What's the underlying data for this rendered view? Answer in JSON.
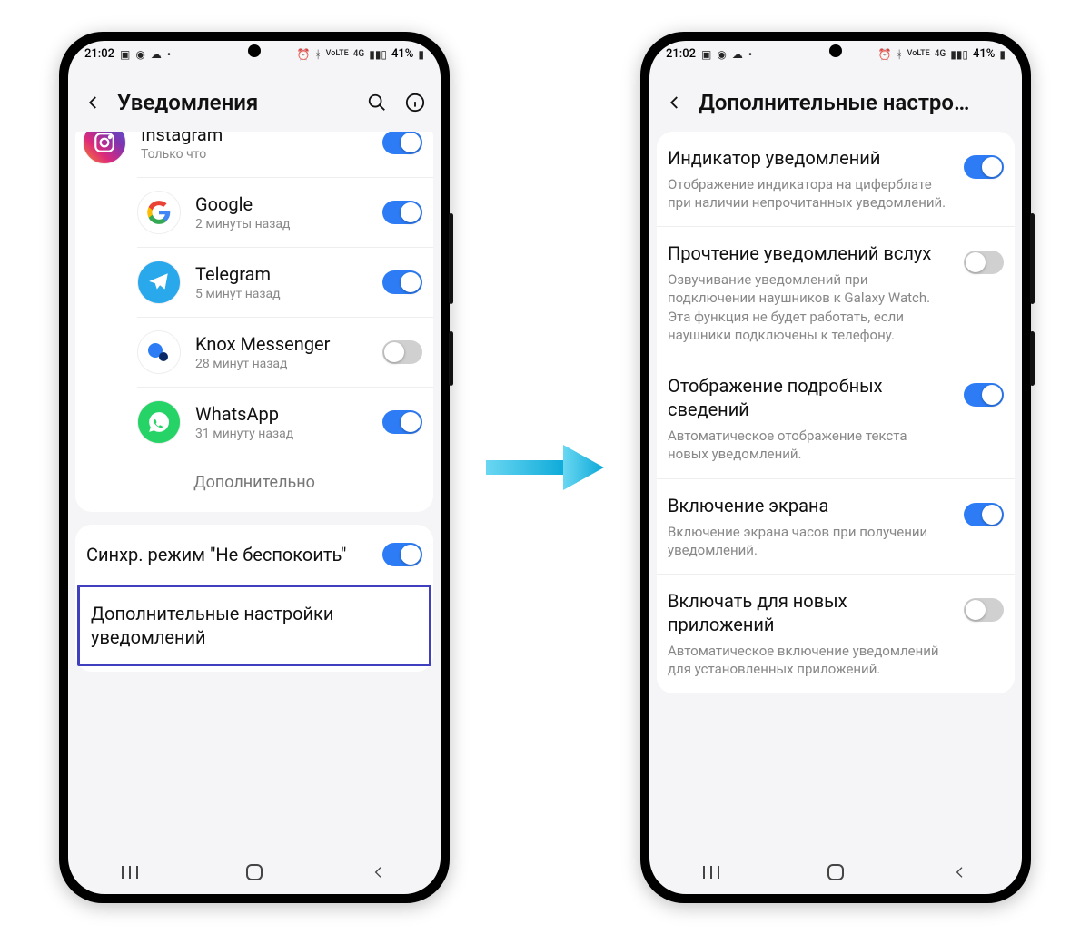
{
  "status": {
    "time": "21:02",
    "battery": "41%"
  },
  "phone1": {
    "title": "Уведомления",
    "apps": [
      {
        "name": "Instagram",
        "sub": "Только что",
        "on": true,
        "icon": "instagram"
      },
      {
        "name": "Google",
        "sub": "2 минуты назад",
        "on": true,
        "icon": "google"
      },
      {
        "name": "Telegram",
        "sub": "5 минут назад",
        "on": true,
        "icon": "telegram"
      },
      {
        "name": "Knox Messenger",
        "sub": "28 минут назад",
        "on": false,
        "icon": "knox"
      },
      {
        "name": "WhatsApp",
        "sub": "31 минуту назад",
        "on": true,
        "icon": "whatsapp"
      }
    ],
    "more": "Дополнительно",
    "sync_dnd": "Синхр. режим \"Не беспокоить\"",
    "sync_dnd_on": true,
    "extra_settings": "Дополнительные настройки уведомлений"
  },
  "phone2": {
    "title": "Дополнительные настро…",
    "settings": [
      {
        "title": "Индикатор уведомлений",
        "desc": "Отображение индикатора на циферблате при наличии непрочитанных уведомлений.",
        "on": true
      },
      {
        "title": "Прочтение уведомлений вслух",
        "desc": "Озвучивание уведомлений при подключении наушников к Galaxy Watch. Эта функция не будет работать, если наушники подключены к телефону.",
        "on": false
      },
      {
        "title": "Отображение подробных сведений",
        "desc": "Автоматическое отображение текста новых уведомлений.",
        "on": true
      },
      {
        "title": "Включение экрана",
        "desc": "Включение экрана часов при получении уведомлений.",
        "on": true
      },
      {
        "title": "Включать для новых приложений",
        "desc": "Автоматическое включение уведомлений для установленных приложений.",
        "on": false
      }
    ]
  }
}
